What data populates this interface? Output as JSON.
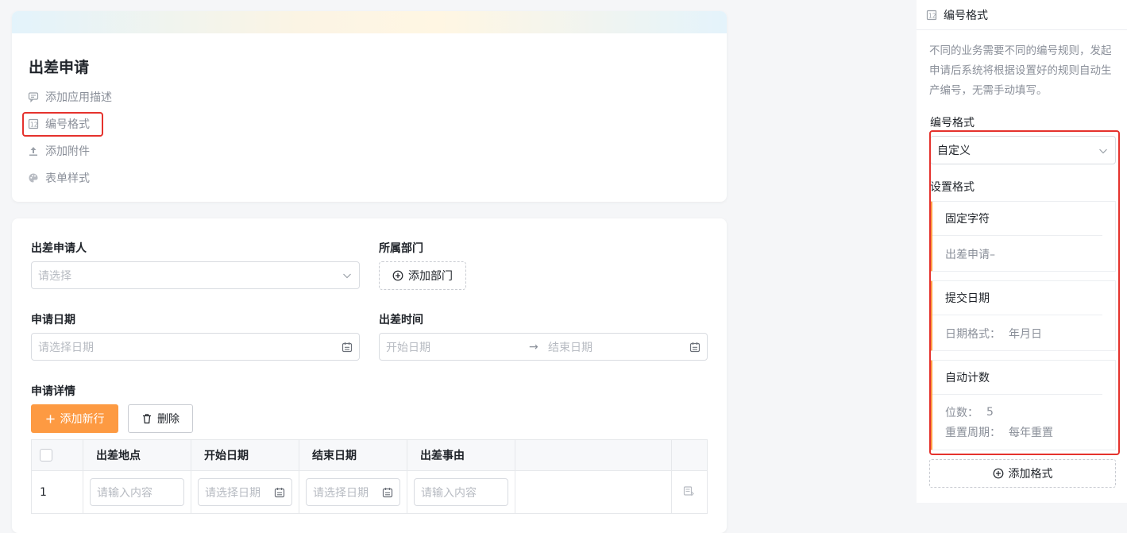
{
  "app": {
    "title": "出差申请",
    "links": [
      {
        "label": "添加应用描述",
        "icon": "comment-icon"
      },
      {
        "label": "编号格式",
        "icon": "numbering-icon"
      },
      {
        "label": "添加附件",
        "icon": "upload-icon"
      },
      {
        "label": "表单样式",
        "icon": "palette-icon"
      }
    ]
  },
  "form": {
    "applicant": {
      "label": "出差申请人",
      "placeholder": "请选择"
    },
    "department": {
      "label": "所属部门",
      "button": "添加部门"
    },
    "apply_date": {
      "label": "申请日期",
      "placeholder": "请选择日期"
    },
    "trip_time": {
      "label": "出差时间",
      "start_placeholder": "开始日期",
      "arrow": "→",
      "end_placeholder": "结束日期"
    },
    "details": {
      "label": "申请详情",
      "add_row": "添加新行",
      "delete": "删除",
      "columns": [
        "出差地点",
        "开始日期",
        "结束日期",
        "出差事由"
      ],
      "rows": [
        {
          "index": "1",
          "location": "请输入内容",
          "start": "请选择日期",
          "end": "请选择日期",
          "reason": "请输入内容"
        }
      ]
    }
  },
  "panel": {
    "header": "编号格式",
    "description": "不同的业务需要不同的编号规则，发起申请后系统将根据设置好的规则自动生产编号，无需手动填写。",
    "format_label": "编号格式",
    "format_value": "自定义",
    "set_format_label": "设置格式",
    "blocks": [
      {
        "title": "固定字符",
        "lines": [
          {
            "label": "出差申请–",
            "value": ""
          }
        ]
      },
      {
        "title": "提交日期",
        "lines": [
          {
            "label": "日期格式：",
            "value": "年月日"
          }
        ]
      },
      {
        "title": "自动计数",
        "lines": [
          {
            "label": "位数：",
            "value": "5"
          },
          {
            "label": "重置周期：",
            "value": "每年重置"
          }
        ]
      }
    ],
    "add_format": "添加格式"
  },
  "colors": {
    "accent": "#fd9a42",
    "highlight": "#e5322d"
  }
}
